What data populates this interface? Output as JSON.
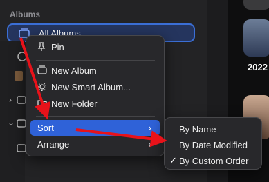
{
  "sidebar": {
    "section_header": "Albums",
    "selected_album": "All Albums"
  },
  "right_panel": {
    "year_label": "2022"
  },
  "context_menu": {
    "items": [
      {
        "label": "Pin",
        "icon": "pin-icon"
      },
      {
        "label": "New Album",
        "icon": "album-icon"
      },
      {
        "label": "New Smart Album...",
        "icon": "smart-album-icon"
      },
      {
        "label": "New Folder",
        "icon": "folder-icon"
      },
      {
        "label": "Sort",
        "has_submenu": true,
        "highlighted": true
      },
      {
        "label": "Arrange",
        "has_submenu": true
      }
    ],
    "chevron": "›"
  },
  "sort_submenu": {
    "items": [
      {
        "label": "By Name",
        "checked": false
      },
      {
        "label": "By Date Modified",
        "checked": false
      },
      {
        "label": "By Custom Order",
        "checked": true
      }
    ],
    "check_glyph": "✓"
  },
  "colors": {
    "highlight": "#2f62d8",
    "annotation_arrow": "#e8121a",
    "selection_border": "#3b6fd6"
  }
}
